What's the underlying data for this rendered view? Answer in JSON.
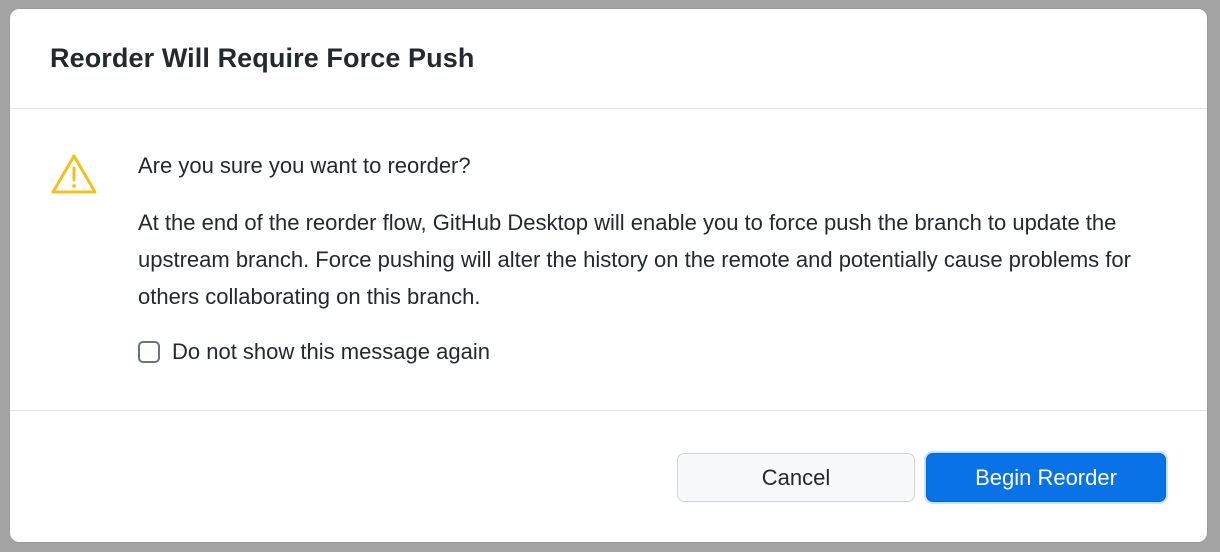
{
  "dialog": {
    "title": "Reorder Will Require Force Push",
    "icon": "warning-icon",
    "question": "Are you sure you want to reorder?",
    "body": "At the end of the reorder flow, GitHub Desktop will enable you to force push the branch to update the upstream branch. Force pushing will alter the history on the remote and potentially cause problems for others collaborating on this branch.",
    "checkbox": {
      "label": "Do not show this message again",
      "checked": false
    },
    "buttons": {
      "cancel_label": "Cancel",
      "confirm_label": "Begin Reorder"
    }
  },
  "colors": {
    "warning": "#f1c21b",
    "primary": "#0972e6",
    "text": "#24292e"
  }
}
